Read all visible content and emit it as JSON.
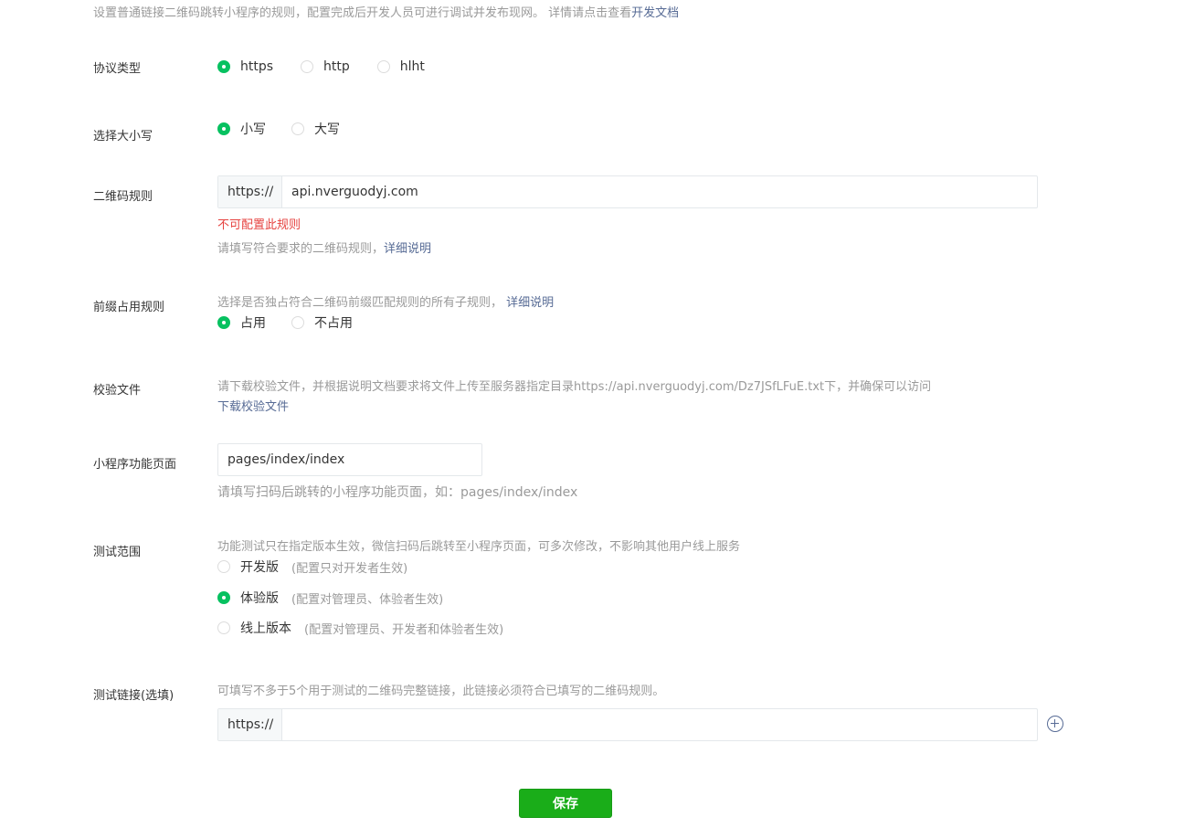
{
  "intro": {
    "text": "设置普通链接二维码跳转小程序的规则，配置完成后开发人员可进行调试并发布现网。 详情请点击查看",
    "link": "开发文档"
  },
  "protocol": {
    "label": "协议类型",
    "options": [
      "https",
      "http",
      "hlht"
    ],
    "selected": "https"
  },
  "case": {
    "label": "选择大小写",
    "options": [
      "小写",
      "大写"
    ],
    "selected": "小写"
  },
  "qr_rule": {
    "label": "二维码规则",
    "prefix": "https://",
    "value": "api.nverguodyj.com",
    "error": "不可配置此规则",
    "hint": "请填写符合要求的二维码规则，",
    "hint_link": "详细说明"
  },
  "prefix_rule": {
    "label": "前缀占用规则",
    "hint": "选择是否独占符合二维码前缀匹配规则的所有子规则，",
    "hint_link": "详细说明",
    "options": [
      "占用",
      "不占用"
    ],
    "selected": "占用"
  },
  "verify_file": {
    "label": "校验文件",
    "hint": "请下载校验文件，并根据说明文档要求将文件上传至服务器指定目录https://api.nverguodyj.com/Dz7JSfLFuE.txt下，并确保可以访问",
    "download_link": "下载校验文件"
  },
  "page_path": {
    "label": "小程序功能页面",
    "value": "pages/index/index",
    "hint": "请填写扫码后跳转的小程序功能页面，如：pages/index/index"
  },
  "test_scope": {
    "label": "测试范围",
    "hint": "功能测试只在指定版本生效，微信扫码后跳转至小程序页面，可多次修改，不影响其他用户线上服务",
    "options": [
      {
        "label": "开发版",
        "desc": "(配置只对开发者生效)"
      },
      {
        "label": "体验版",
        "desc": "(配置对管理员、体验者生效)"
      },
      {
        "label": "线上版本",
        "desc": "(配置对管理员、开发者和体验者生效)"
      }
    ],
    "selected": "体验版"
  },
  "test_link": {
    "label": "测试链接(选填)",
    "hint": "可填写不多于5个用于测试的二维码完整链接，此链接必须符合已填写的二维码规则。",
    "prefix": "https://",
    "value": ""
  },
  "save_label": "保存",
  "colors": {
    "accent": "#07c160",
    "button": "#1aad19",
    "link": "#576b95",
    "error": "#e64340"
  }
}
